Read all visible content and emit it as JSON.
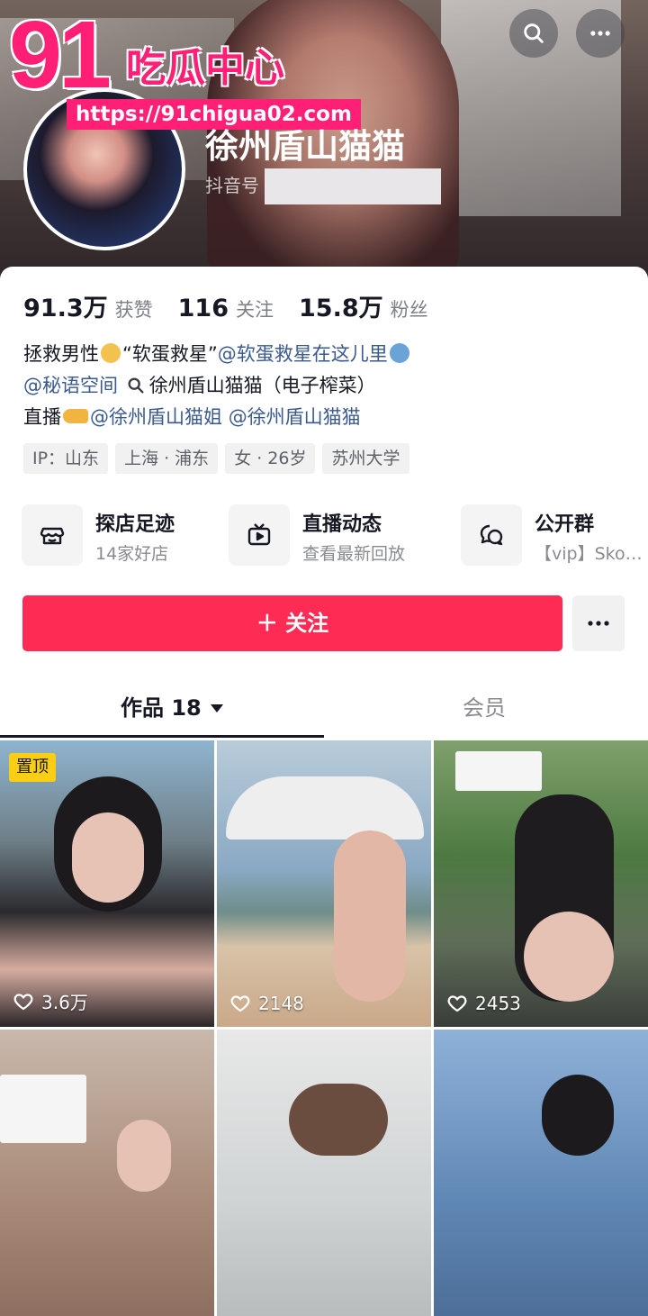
{
  "watermark": {
    "number": "91",
    "name": "吃瓜中心",
    "url": "https://91chigua02.com"
  },
  "profile": {
    "nickname": "徐州盾山猫猫",
    "id_label": "抖音号"
  },
  "stats": [
    {
      "value": "91.3万",
      "label": "获赞"
    },
    {
      "value": "116",
      "label": "关注"
    },
    {
      "value": "15.8万",
      "label": "粉丝"
    }
  ],
  "bio": {
    "line1": {
      "text1": "拯救男性",
      "quote": "“软蛋救星”",
      "mention": "@软蛋救星在这儿里"
    },
    "line2": {
      "mention": "@秘语空间",
      "text": "徐州盾山猫猫（电子榨菜）"
    },
    "line3": {
      "text": "直播",
      "mention1": "@徐州盾山猫姐",
      "mention2": "@徐州盾山猫猫"
    }
  },
  "tags": [
    "IP：山东",
    "上海 · 浦东",
    "女 · 26岁",
    "苏州大学"
  ],
  "features": [
    {
      "title": "探店足迹",
      "subtitle": "14家好店",
      "icon": "store-icon"
    },
    {
      "title": "直播动态",
      "subtitle": "查看最新回放",
      "icon": "tv-icon"
    },
    {
      "title": "公开群",
      "subtitle": "【vip】Sko…",
      "icon": "chat-group-icon"
    }
  ],
  "actions": {
    "follow_label": "＋ 关注"
  },
  "tabs": {
    "works_label": "作品 18",
    "members_label": "会员"
  },
  "videos": [
    {
      "likes": "3.6万",
      "pinned_label": "置顶"
    },
    {
      "likes": "2148"
    },
    {
      "likes": "2453"
    },
    {
      "likes": ""
    },
    {
      "likes": ""
    },
    {
      "likes": ""
    }
  ],
  "colors": {
    "accent": "#fe2c55",
    "watermark": "#ff1f75",
    "pinned_badge": "#face15",
    "mention": "#3a5a8f"
  }
}
